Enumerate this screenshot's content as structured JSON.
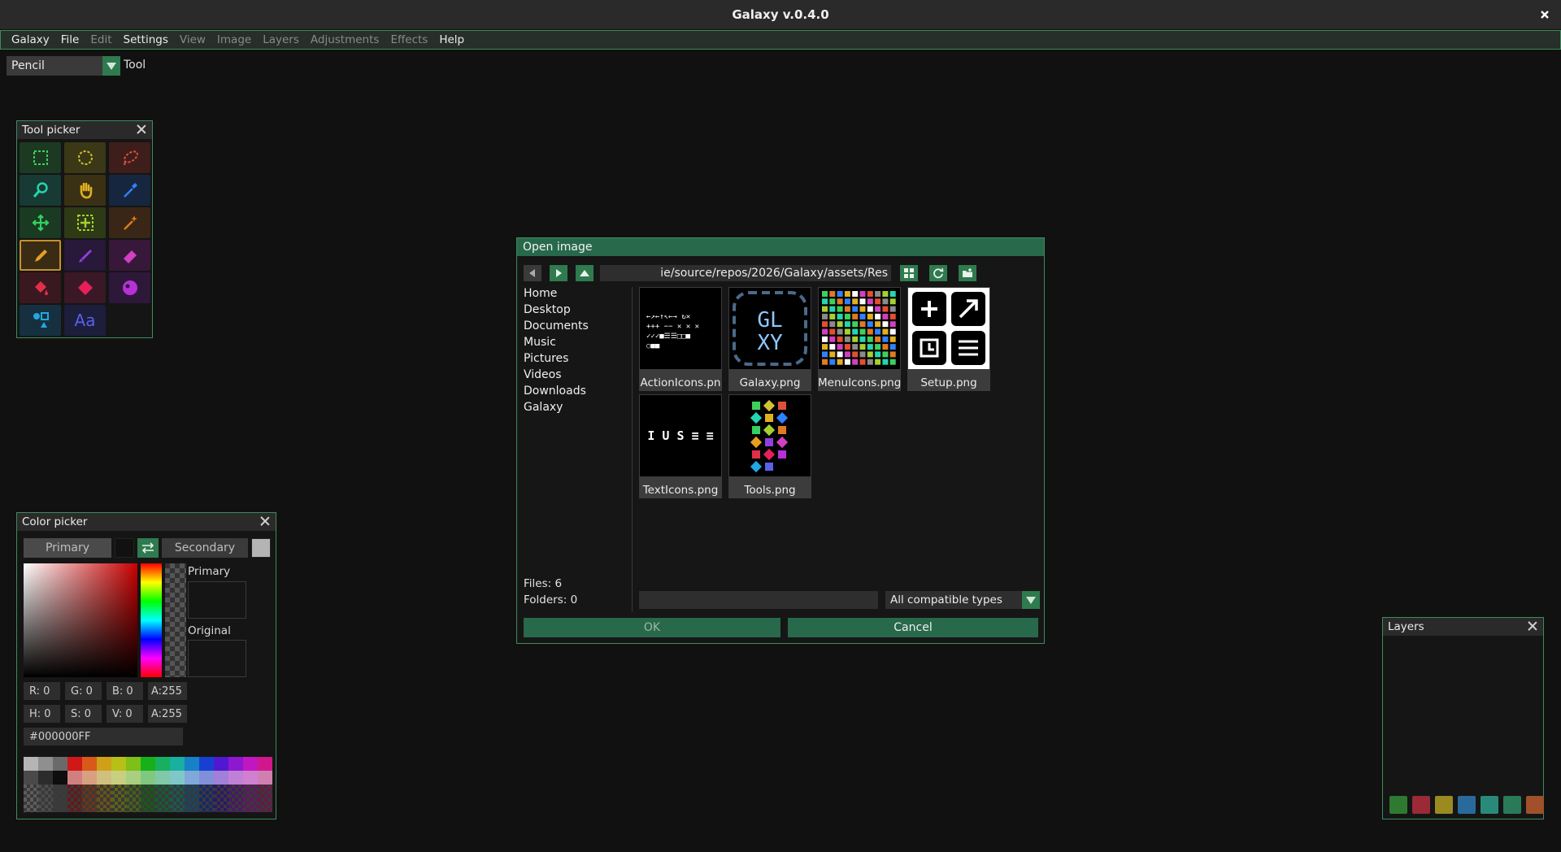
{
  "window": {
    "title": "Galaxy v.0.4.0"
  },
  "menubar": {
    "items": [
      {
        "label": "Galaxy",
        "enabled": true
      },
      {
        "label": "File",
        "enabled": true
      },
      {
        "label": "Edit",
        "enabled": false
      },
      {
        "label": "Settings",
        "enabled": true
      },
      {
        "label": "View",
        "enabled": false
      },
      {
        "label": "Image",
        "enabled": false
      },
      {
        "label": "Layers",
        "enabled": false
      },
      {
        "label": "Adjustments",
        "enabled": false
      },
      {
        "label": "Effects",
        "enabled": false
      },
      {
        "label": "Help",
        "enabled": true
      }
    ]
  },
  "toolbar": {
    "selected_tool": "Pencil",
    "tool_label": "Tool"
  },
  "tool_picker": {
    "title": "Tool picker",
    "tools": [
      {
        "name": "rectangle-select",
        "icon": "rect-select-icon",
        "color": "#3fd05c",
        "bg": "#1c3a22",
        "selected": false
      },
      {
        "name": "ellipse-select",
        "icon": "ellipse-select-icon",
        "color": "#d4c234",
        "bg": "#3a3816",
        "selected": false
      },
      {
        "name": "lasso-select",
        "icon": "lasso-icon",
        "color": "#e0503a",
        "bg": "#3e1e1a",
        "selected": false
      },
      {
        "name": "zoom",
        "icon": "zoom-icon",
        "color": "#24d6b0",
        "bg": "#173a35",
        "selected": false
      },
      {
        "name": "pan",
        "icon": "hand-icon",
        "color": "#e0b020",
        "bg": "#3a3014",
        "selected": false
      },
      {
        "name": "color-picker",
        "icon": "eyedropper-icon",
        "color": "#3080ff",
        "bg": "#17263f",
        "selected": false
      },
      {
        "name": "move",
        "icon": "move-icon",
        "color": "#34d060",
        "bg": "#1a3a22",
        "selected": false
      },
      {
        "name": "move-selection",
        "icon": "move-selection-icon",
        "color": "#a6d030",
        "bg": "#2e3a16",
        "selected": false
      },
      {
        "name": "magic-wand",
        "icon": "magic-wand-icon",
        "color": "#e07a20",
        "bg": "#3a2616",
        "selected": false
      },
      {
        "name": "pencil",
        "icon": "pencil-icon",
        "color": "#e8a020",
        "bg": "#3a2c14",
        "selected": true
      },
      {
        "name": "brush",
        "icon": "brush-icon",
        "color": "#9040e0",
        "bg": "#28183a",
        "selected": false
      },
      {
        "name": "eraser",
        "icon": "eraser-icon",
        "color": "#d040c0",
        "bg": "#38183a",
        "selected": false
      },
      {
        "name": "fill",
        "icon": "paint-bucket-icon",
        "color": "#e03048",
        "bg": "#3a1820",
        "selected": false
      },
      {
        "name": "gradient",
        "icon": "gradient-icon",
        "color": "#e8205a",
        "bg": "#3a1826",
        "selected": false
      },
      {
        "name": "recolor",
        "icon": "recolor-icon",
        "color": "#b830d8",
        "bg": "#2e183a",
        "selected": false
      },
      {
        "name": "shapes",
        "icon": "shapes-icon",
        "color": "#20a8e0",
        "bg": "#173040",
        "selected": false
      },
      {
        "name": "text",
        "icon": "text-icon",
        "color": "#5a60e8",
        "bg": "#1c1e3c",
        "selected": false,
        "glyph": "Aa"
      }
    ]
  },
  "color_picker": {
    "title": "Color picker",
    "primary_label": "Primary",
    "secondary_label": "Secondary",
    "primary_color": "#111111",
    "secondary_color": "#b4b4b4",
    "preview_primary_label": "Primary",
    "preview_original_label": "Original",
    "rgba": {
      "r": "R:  0",
      "g": "G:  0",
      "b": "B:  0",
      "a": "A:255"
    },
    "hsva": {
      "h": "H:  0",
      "s": "S:  0",
      "v": "V:  0",
      "a": "A:255"
    },
    "hex": "#000000FF",
    "palette": [
      "#b5b5b5",
      "#8f8f8f",
      "#6a6a6a",
      "#d01818",
      "#d85a18",
      "#d0a018",
      "#b8c018",
      "#7ec018",
      "#18b018",
      "#18b060",
      "#18b0a0",
      "#1880c8",
      "#1840d0",
      "#5018d0",
      "#8c18d0",
      "#c018c0",
      "#d0188c",
      "#4a4a4a",
      "#2c2c2c",
      "#0e0e0e",
      "#d08080",
      "#d8a080",
      "#d0c080",
      "#c8d080",
      "#a8d080",
      "#80c880",
      "#80c8a8",
      "#80c8c8",
      "#80a8d8",
      "#8090d8",
      "#a080d8",
      "#c080d8",
      "#d080d0",
      "#d080b0"
    ]
  },
  "layers_panel": {
    "title": "Layers"
  },
  "open_dialog": {
    "title": "Open image",
    "path": "ie/source/repos/2026/Galaxy/assets/Res",
    "places": [
      "Home",
      "Desktop",
      "Documents",
      "Music",
      "Pictures",
      "Videos",
      "Downloads",
      "Galaxy"
    ],
    "files_count": "Files: 6",
    "folders_count": "Folders: 0",
    "files": [
      {
        "name": "ActionIcons.pn",
        "thumb": "action-icons"
      },
      {
        "name": "Galaxy.png",
        "thumb": "galaxy-logo"
      },
      {
        "name": "MenuIcons.png",
        "thumb": "menu-icons"
      },
      {
        "name": "Setup.png",
        "thumb": "setup"
      },
      {
        "name": "TextIcons.png",
        "thumb": "text-icons"
      },
      {
        "name": "Tools.png",
        "thumb": "tools"
      }
    ],
    "filename_value": "",
    "file_type": "All compatible types",
    "ok_label": "OK",
    "cancel_label": "Cancel"
  }
}
